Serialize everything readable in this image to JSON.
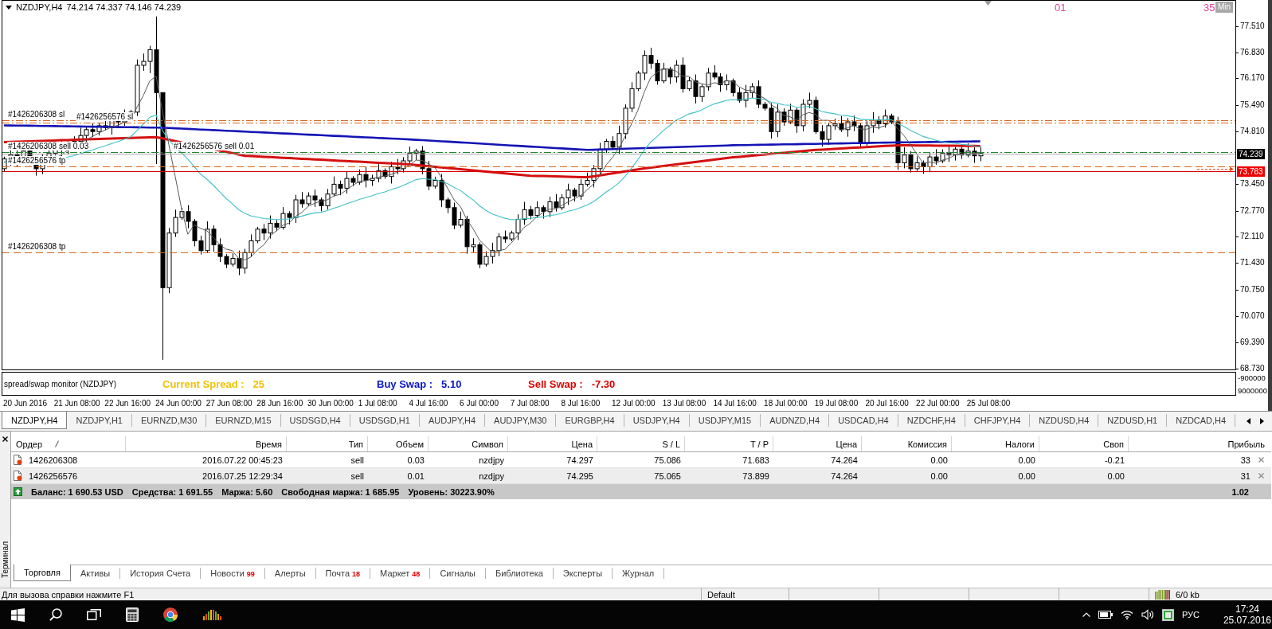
{
  "chart": {
    "title": "NZDJPY,H4",
    "ohlc": "74.214 74.337 74.146 74.239",
    "timer": [
      "01",
      "35"
    ],
    "timer_unit": "Min",
    "order_lines": [
      {
        "kind": "sl",
        "label": "#1426206308 sl"
      },
      {
        "kind": "sl",
        "label": "#1426256576 sl"
      },
      {
        "kind": "open",
        "label": "#1426206308 sell 0.03"
      },
      {
        "kind": "open",
        "label": "#1426256576 sell 0.01"
      },
      {
        "kind": "tp",
        "label": "#1426256576 tp"
      },
      {
        "kind": "tp",
        "label": "#1426206308 tp"
      }
    ],
    "price_axis": [
      "77.510",
      "76.830",
      "76.170",
      "75.490",
      "74.810",
      "73.450",
      "72.770",
      "72.110",
      "71.430",
      "70.750",
      "70.070",
      "69.390",
      "68.730"
    ],
    "price_tags": [
      {
        "kind": "bid",
        "text": "74.239"
      },
      {
        "kind": "level",
        "text": "73.783"
      }
    ],
    "time_axis": [
      "20 Jun 2016",
      "21 Jun 08:00",
      "22 Jun 16:00",
      "24 Jun 00:00",
      "27 Jun 08:00",
      "28 Jun 16:00",
      "30 Jun 00:00",
      "1 Jul 08:00",
      "4 Jul 16:00",
      "6 Jul 00:00",
      "7 Jul 08:00",
      "8 Jul 16:00",
      "12 Jul 00:00",
      "13 Jul 08:00",
      "14 Jul 16:00",
      "18 Jul 00:00",
      "19 Jul 08:00",
      "20 Jul 16:00",
      "22 Jul 00:00",
      "25 Jul 08:00"
    ]
  },
  "indicator": {
    "title": "spread/swap monitor (NZDJPY)",
    "items": [
      {
        "label": "Current Spread :",
        "value": "25",
        "color": "#f2c200"
      },
      {
        "label": "Buy Swap :",
        "value": "5.10",
        "color": "#0a14c8"
      },
      {
        "label": "Sell Swap :",
        "value": "-7.30",
        "color": "#e00000"
      }
    ],
    "scale": [
      "-900000",
      "9000000"
    ]
  },
  "chart_tabs": [
    {
      "label": "NZDJPY,H4",
      "selected": true
    },
    {
      "label": "NZDJPY,H1",
      "selected": false
    },
    {
      "label": "EURNZD,M30",
      "selected": false
    },
    {
      "label": "EURNZD,M15",
      "selected": false
    },
    {
      "label": "USDSGD,H4",
      "selected": false
    },
    {
      "label": "USDSGD,H1",
      "selected": false
    },
    {
      "label": "AUDJPY,H4",
      "selected": false
    },
    {
      "label": "AUDJPY,M30",
      "selected": false
    },
    {
      "label": "EURGBP,H4",
      "selected": false
    },
    {
      "label": "USDJPY,H4",
      "selected": false
    },
    {
      "label": "USDJPY,M15",
      "selected": false
    },
    {
      "label": "AUDNZD,H4",
      "selected": false
    },
    {
      "label": "USDCAD,H4",
      "selected": false
    },
    {
      "label": "NZDCHF,H4",
      "selected": false
    },
    {
      "label": "CHFJPY,H4",
      "selected": false
    },
    {
      "label": "NZDUSD,H4",
      "selected": false
    },
    {
      "label": "NZDUSD,H1",
      "selected": false
    },
    {
      "label": "NZDCAD,H4",
      "selected": false
    }
  ],
  "terminal": {
    "title": "Терминал",
    "columns": [
      {
        "label": "Ордер",
        "sorted": true
      },
      {
        "label": "Время",
        "sorted": false
      },
      {
        "label": "Тип",
        "sorted": false
      },
      {
        "label": "Объем",
        "sorted": false
      },
      {
        "label": "Символ",
        "sorted": false
      },
      {
        "label": "Цена",
        "sorted": false
      },
      {
        "label": "S / L",
        "sorted": false
      },
      {
        "label": "T / P",
        "sorted": false
      },
      {
        "label": "Цена",
        "sorted": false
      },
      {
        "label": "Комиссия",
        "sorted": false
      },
      {
        "label": "Налоги",
        "sorted": false
      },
      {
        "label": "Своп",
        "sorted": false
      },
      {
        "label": "Прибыль",
        "sorted": false
      }
    ],
    "orders": [
      {
        "selected": false,
        "cells": [
          "1426206308",
          "2016.07.22 00:45:23",
          "sell",
          "0.03",
          "nzdjpy",
          "74.297",
          "75.086",
          "71.683",
          "74.264",
          "0.00",
          "0.00",
          "-0.21",
          "33"
        ]
      },
      {
        "selected": true,
        "cells": [
          "1426256576",
          "2016.07.25 12:29:34",
          "sell",
          "0.01",
          "nzdjpy",
          "74.295",
          "75.065",
          "73.899",
          "74.264",
          "0.00",
          "0.00",
          "0.00",
          "31"
        ]
      }
    ],
    "summary": {
      "items": [
        "Баланс: 1 690.53 USD",
        "Средства: 1 691.55",
        "Маржа: 5.60",
        "Свободная маржа: 1 685.95",
        "Уровень: 30223.90%"
      ],
      "total": "1.02"
    },
    "tabs": [
      {
        "label": "Торговля",
        "selected": true
      },
      {
        "label": "Активы",
        "selected": false
      },
      {
        "label": "История Счета",
        "selected": false
      },
      {
        "label": "Новости",
        "badge": "99",
        "selected": false
      },
      {
        "label": "Алерты",
        "selected": false
      },
      {
        "label": "Почта",
        "badge": "18",
        "selected": false
      },
      {
        "label": "Маркет",
        "badge": "48",
        "selected": false
      },
      {
        "label": "Сигналы",
        "selected": false
      },
      {
        "label": "Библиотека",
        "selected": false
      },
      {
        "label": "Эксперты",
        "selected": false
      },
      {
        "label": "Журнал",
        "selected": false
      }
    ]
  },
  "status_bar": {
    "help": "Для вызова справки нажмите F1",
    "profile": "Default",
    "traffic": "6/0 kb"
  },
  "taskbar": {
    "language": "РУС",
    "time": "17:24",
    "date": "25.07.2016"
  }
}
